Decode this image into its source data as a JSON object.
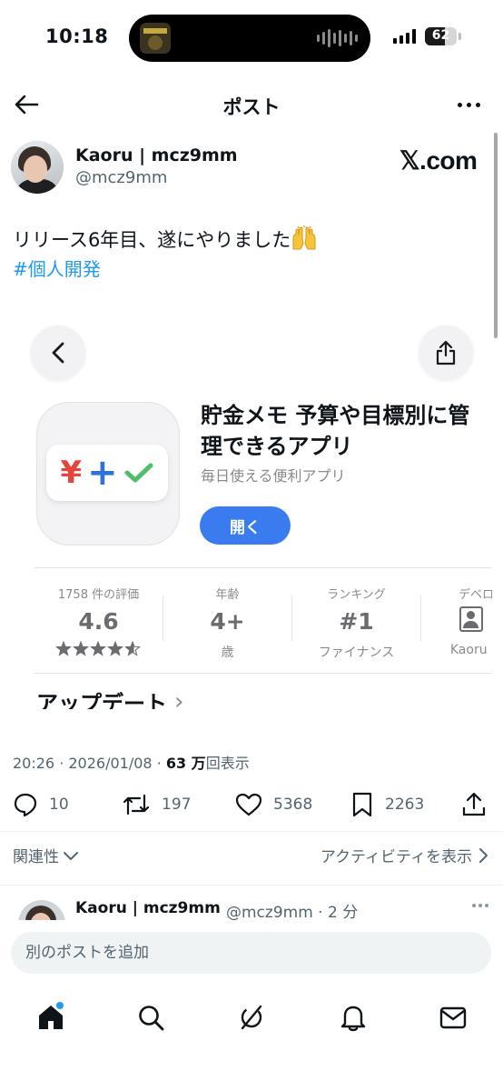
{
  "status_bar": {
    "time": "10:18",
    "battery_text": "62",
    "battery_level": 0.62
  },
  "header": {
    "title": "ポスト",
    "back_icon": "arrow-left-icon",
    "more_icon": "more-horizontal-icon"
  },
  "post": {
    "author_name": "Kaoru | mcz9mm",
    "author_handle": "@mcz9mm",
    "watermark": "𝕏.com",
    "text": "リリース6年目、遂にやりました",
    "emoji_icon": "raising-hands-icon",
    "hashtag": "#個人開発",
    "timestamp": "20:26 · 2026/01/08 · ",
    "views_count": "63 万",
    "views_label": "回表示"
  },
  "app_card": {
    "back_icon": "chevron-left-icon",
    "share_icon": "share-icon",
    "app_name": "貯金メモ 予算や目標別に管理できるアプリ",
    "app_subtitle": "毎日使える便利アプリ",
    "icon_yen": "¥",
    "icon_plus": "+",
    "open_label": "開く",
    "stats": [
      {
        "label": "1758 件の評価",
        "value": "4.6",
        "stars": "★★★★★"
      },
      {
        "label": "年齢",
        "value": "4+",
        "sub": "歳"
      },
      {
        "label": "ランキング",
        "value": "#1",
        "sub": "ファイナンス"
      },
      {
        "label": "デベロ",
        "sub": "Kaoru M"
      }
    ],
    "rating": 4.6,
    "updates_label": "アップデート"
  },
  "actions": {
    "replies": "10",
    "reposts": "197",
    "likes": "5368",
    "bookmarks": "2263"
  },
  "sort": {
    "label": "関連性",
    "activity_label": "アクティビティを表示"
  },
  "reply": {
    "author_name": "Kaoru | mcz9mm",
    "author_handle": "@mcz9mm · 2 分"
  },
  "composer": {
    "placeholder": "別のポストを追加"
  },
  "tab_bar": {
    "items": [
      "home-icon",
      "search-icon",
      "grok-icon",
      "notifications-icon",
      "messages-icon"
    ]
  },
  "colors": {
    "accent": "#1d9bf0",
    "open_button": "#3a7cf0",
    "text_primary": "#0f1419",
    "text_secondary": "#536471"
  }
}
